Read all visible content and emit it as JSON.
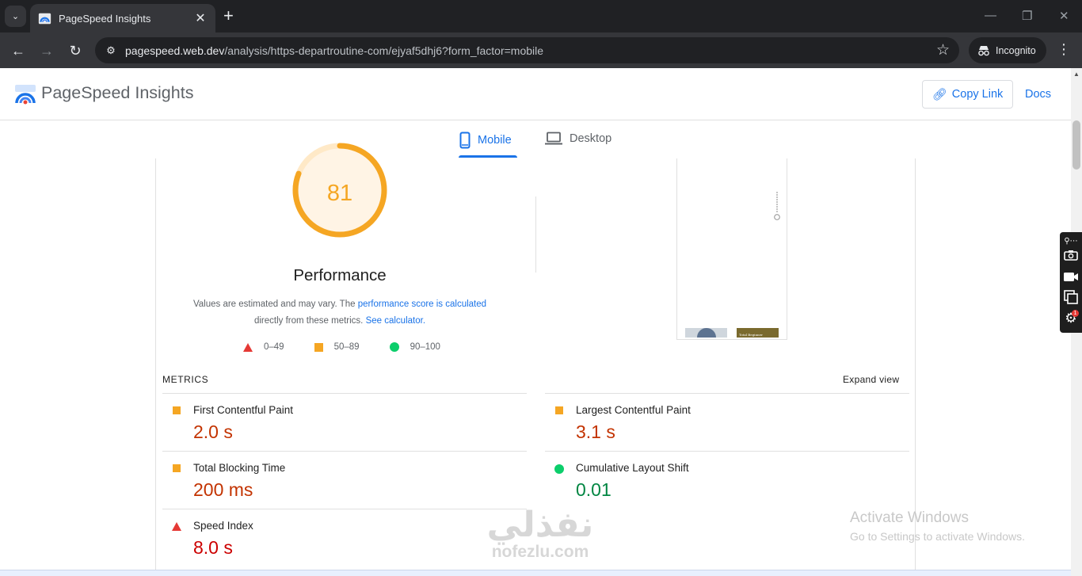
{
  "browser": {
    "tab": {
      "title": "PageSpeed Insights",
      "close": "✕"
    },
    "new_tab": "+",
    "window": {
      "minimize": "—",
      "restore": "❐",
      "close": "✕"
    },
    "nav": {
      "back": "←",
      "forward": "→",
      "reload": "↻"
    },
    "url": {
      "host": "pagespeed.web.dev",
      "path": "/analysis/https-departroutine-com/ejyaf5dhj6?form_factor=mobile"
    },
    "incognito_label": "Incognito",
    "menu": "⋮"
  },
  "header": {
    "title": "PageSpeed Insights",
    "copy_link": "Copy Link",
    "docs": "Docs"
  },
  "form_factor_tabs": [
    {
      "label": "Mobile",
      "active": true
    },
    {
      "label": "Desktop",
      "active": false
    }
  ],
  "performance": {
    "score": "81",
    "score_fraction": 0.81,
    "label": "Performance",
    "disclaimer_pre": "Values are estimated and may vary. The ",
    "disclaimer_link1": "performance score is calculated",
    "disclaimer_mid": " directly from these metrics. ",
    "disclaimer_link2": "See calculator."
  },
  "legend": [
    {
      "range": "0–49",
      "shape": "triangle",
      "color": "#e53935"
    },
    {
      "range": "50–89",
      "shape": "square",
      "color": "#f5a623"
    },
    {
      "range": "90–100",
      "shape": "circle",
      "color": "#0cce6b"
    }
  ],
  "metrics": {
    "heading": "METRICS",
    "expand": "Expand view",
    "items": [
      {
        "name": "First Contentful Paint",
        "value": "2.0 s",
        "status": "average"
      },
      {
        "name": "Largest Contentful Paint",
        "value": "3.1 s",
        "status": "average"
      },
      {
        "name": "Total Blocking Time",
        "value": "200 ms",
        "status": "average"
      },
      {
        "name": "Cumulative Layout Shift",
        "value": "0.01",
        "status": "good"
      },
      {
        "name": "Speed Index",
        "value": "8.0 s",
        "status": "poor"
      }
    ]
  },
  "screenshot": {
    "thumb2_caption": "Total Beginner"
  },
  "os_overlay": {
    "activate_title": "Activate Windows",
    "activate_sub": "Go to Settings to activate Windows."
  },
  "watermark": {
    "arabic": "نفذلي",
    "latin": "nofezlu.com"
  },
  "side_panel": {
    "badge": "1"
  },
  "colors": {
    "accent": "#1a73e8",
    "average": "#f5a623",
    "good": "#0cce6b",
    "poor": "#e53935"
  }
}
